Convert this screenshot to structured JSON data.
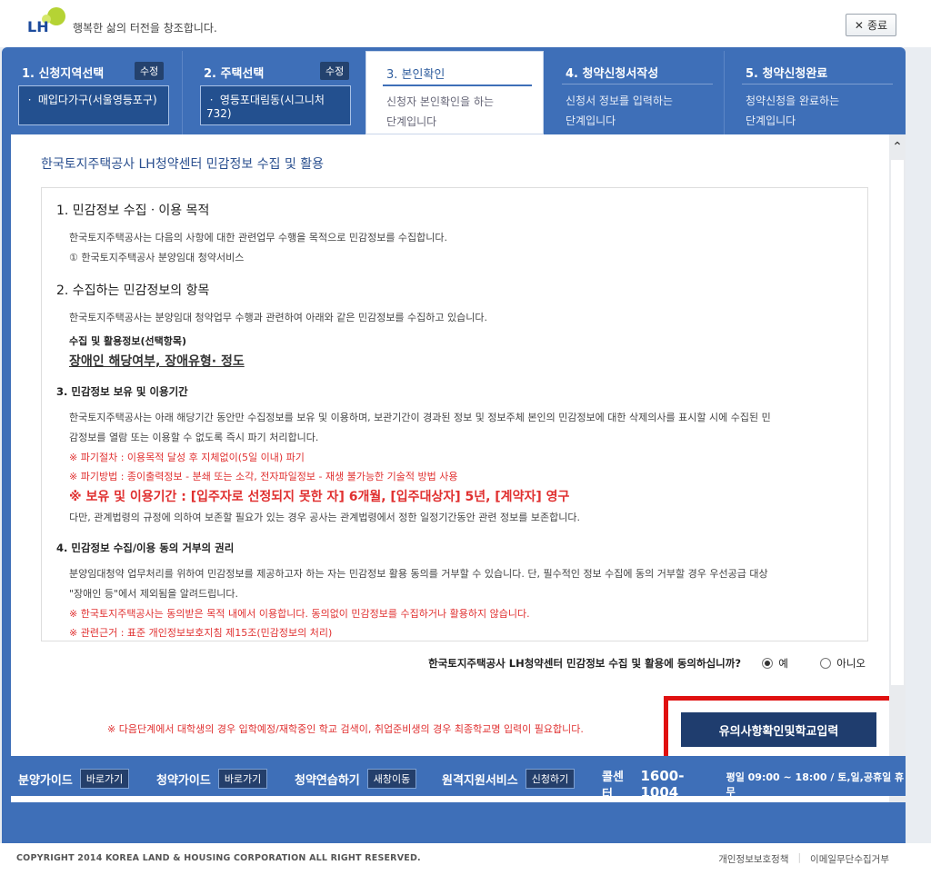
{
  "header": {
    "logo_text": "LH",
    "slogan": "행복한 삶의 터전을 창조합니다.",
    "close_label": "종료"
  },
  "steps": [
    {
      "title": "1. 신청지역선택",
      "edit": "수정",
      "value": "ㆍ 매입다가구(서울영등포구)"
    },
    {
      "title": "2. 주택선택",
      "edit": "수정",
      "value": "ㆍ 영등포대림동(시그니처732)"
    },
    {
      "title": "3. 본인확인",
      "desc1": "신청자 본인확인을 하는",
      "desc2": "단계입니다"
    },
    {
      "title": "4. 청약신청서작성",
      "desc1": "신청서 정보를 입력하는",
      "desc2": "단계입니다"
    },
    {
      "title": "5. 청약신청완료",
      "desc1": "청약신청을 완료하는",
      "desc2": "단계입니다"
    }
  ],
  "content": {
    "section_title": "한국토지주택공사 LH청약센터 민감정보 수집 및 활용",
    "s1_title": "1. 민감정보 수집ㆍ이용 목적",
    "s1_p1": "한국토지주택공사는 다음의 사항에 대한 관련업무 수행을 목적으로 민감정보를 수집합니다.",
    "s1_p2": "① 한국토지주택공사 분양임대 청약서비스",
    "s2_title": "2. 수집하는 민감정보의 항목",
    "s2_p1": "한국토지주택공사는 분양임대 청약업무 수행과 관련하여 아래와 같은 민감정보를 수집하고 있습니다.",
    "s2_sub": "수집 및 활용정보(선택항목)",
    "s2_items": "장애인 해당여부,  장애유형· 정도",
    "s3_title": "3. 민감정보 보유 및 이용기간",
    "s3_p1": "한국토지주택공사는 아래 해당기간 동안만 수집정보를 보유 및 이용하며, 보관기간이 경과된 정보 및 정보주체 본인의 민감정보에 대한 삭제의사를 표시할 시에 수집된 민",
    "s3_p2": "감정보를 열람 또는 이용할 수 없도록 즉시 파기 처리합니다.",
    "s3_red1": "※ 파기절차 : 이용목적 달성 후 지체없이(5일 이내) 파기",
    "s3_red2": "※ 파기방법 : 종이출력정보 - 분쇄 또는 소각, 전자파일정보 - 재생 불가능한 기술적 방법 사용",
    "s3_red_big": "※ 보유 및 이용기간 : [입주자로 선정되지 못한 자] 6개월, [입주대상자] 5년, [계약자] 영구",
    "s3_p3": "다만, 관계법령의 규정에 의하여 보존할 필요가 있는 경우 공사는 관계법령에서 정한 일정기간동안 관련 정보를 보존합니다.",
    "s4_title": "4. 민감정보 수집/이용 동의 거부의 권리",
    "s4_p1": "분양임대청약 업무처리를 위하여 민감정보를 제공하고자 하는 자는 민감정보 활용 동의를 거부할 수 있습니다. 단, 필수적인 정보 수집에 동의 거부할 경우 우선공급 대상",
    "s4_p2": "\"장애인 등\"에서 제외됨을 알려드립니다.",
    "s4_red1": "※ 한국토지주택공사는 동의받은 목적 내에서 이용합니다. 동의없이 민감정보를 수집하거나 활용하지 않습니다.",
    "s4_red2": "※ 관련근거 : 표준 개인정보보호지침 제15조(민감정보의 처리)",
    "agree_question": "한국토지주택공사 LH청약센터 민감정보 수집 및 활용에 동의하십니까?",
    "agree_yes": "예",
    "agree_no": "아니오",
    "notice": "※ 다음단계에서 대학생의 경우 입학예정/재학중인 학교 검색이, 취업준비생의 경우 최종학교명 입력이 필요합니다.",
    "next_button": "유의사항확인및학교입력"
  },
  "bottom_bar": {
    "guide1": "분양가이드",
    "guide1_btn": "바로가기",
    "guide2": "청약가이드",
    "guide2_btn": "바로가기",
    "practice": "청약연습하기",
    "practice_btn": "새창이동",
    "remote": "원격지원서비스",
    "remote_btn": "신청하기",
    "call_label": "콜센터",
    "call_number": "1600-1004",
    "hours": "평일 09:00 ~ 18:00 / 토,일,공휴일 휴무"
  },
  "footer": {
    "copyright": "COPYRIGHT 2014 KOREA LAND & HOUSING CORPORATION ALL RIGHT RESERVED.",
    "link1": "개인정보보호정책",
    "link2": "이메일무단수집거부"
  },
  "colors": {
    "brand_blue": "#3e6fb8",
    "dark_navy": "#1f3d6e",
    "alert_red": "#e03030"
  }
}
